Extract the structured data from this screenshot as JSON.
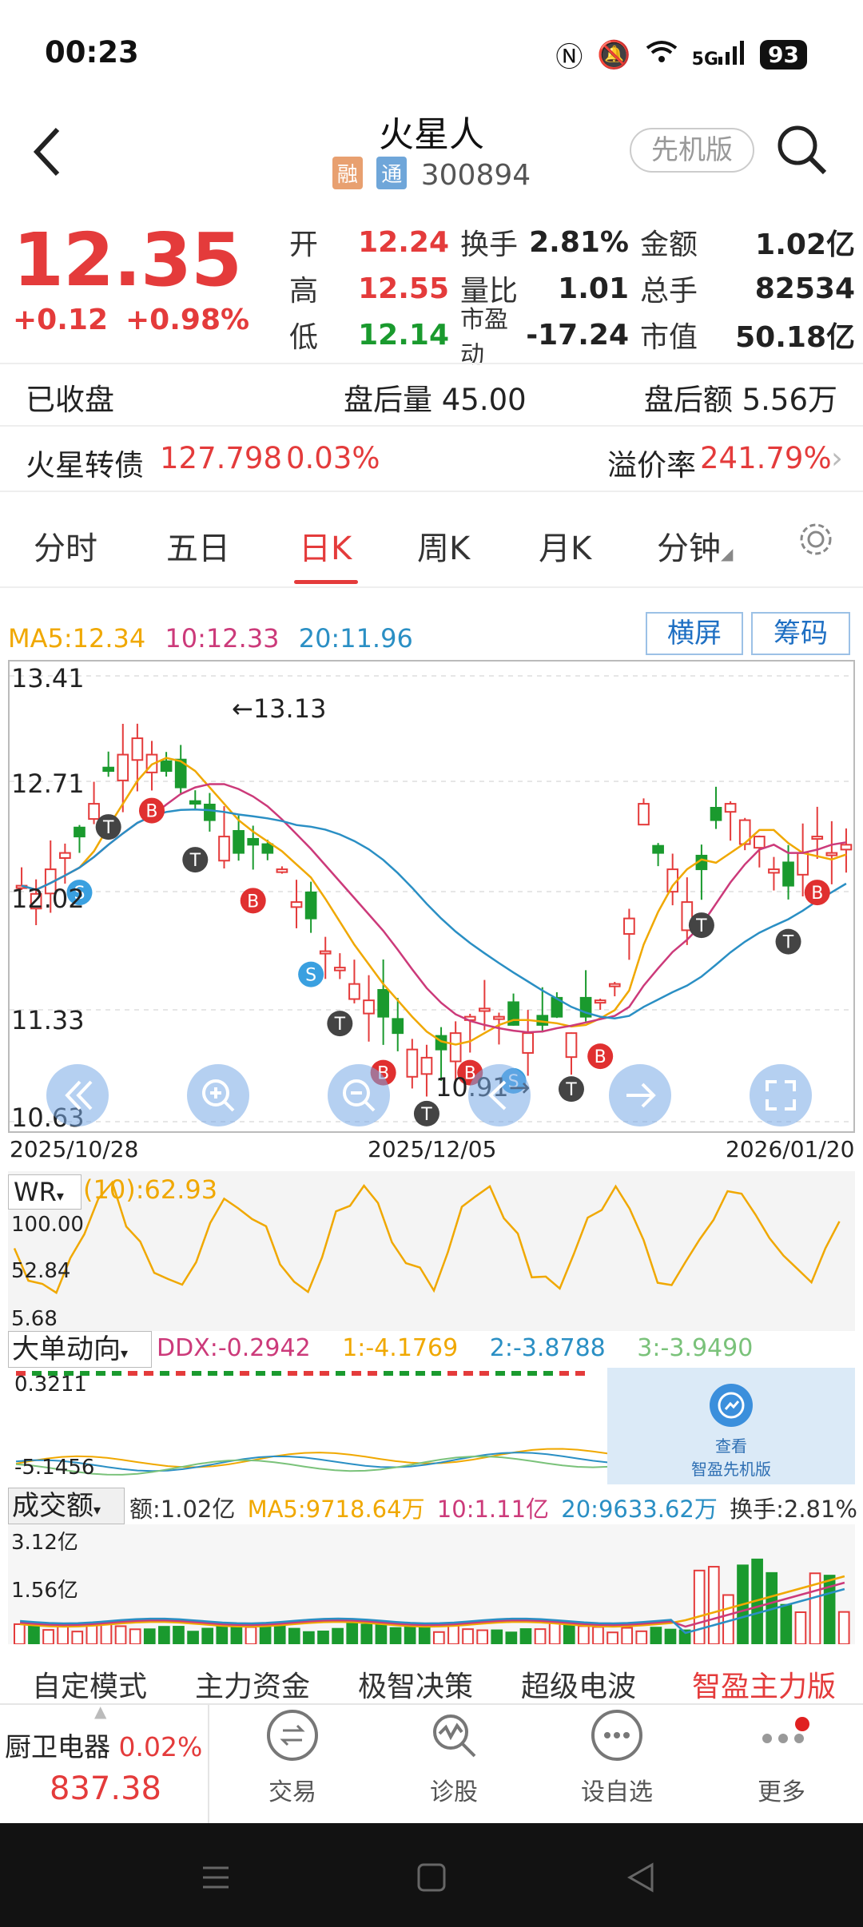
{
  "status": {
    "time": "00:23",
    "battery": "93",
    "signal": "5G"
  },
  "header": {
    "title": "火星人",
    "badge1": "融",
    "badge2": "通",
    "code": "300894",
    "version_btn": "先机版"
  },
  "quote": {
    "price": "12.35",
    "change": "+0.12",
    "change_pct": "+0.98%",
    "rows": [
      {
        "l1": "开",
        "v1": "12.24",
        "l2": "换手",
        "v2": "2.81%",
        "l3": "金额",
        "v3": "1.02亿"
      },
      {
        "l1": "高",
        "v1": "12.55",
        "l2": "量比",
        "v2": "1.01",
        "l3": "总手",
        "v3": "82534"
      },
      {
        "l1": "低",
        "v1": "12.14",
        "l2": "市盈动",
        "v2": "-17.24",
        "l3": "市值",
        "v3": "50.18亿"
      }
    ]
  },
  "after_hours": {
    "status": "已收盘",
    "volume": "盘后量 45.00",
    "amount": "盘后额 5.56万"
  },
  "bond": {
    "name": "火星转债",
    "price": "127.798",
    "pct": "0.03%",
    "premium_label": "溢价率",
    "premium": "241.79%"
  },
  "tabs": [
    "分时",
    "五日",
    "日K",
    "周K",
    "月K",
    "分钟"
  ],
  "active_tab": "日K",
  "ma": {
    "ma5": "MA5:12.34",
    "ma10": "10:12.33",
    "ma20": "20:11.96"
  },
  "buttons": {
    "landscape": "横屏",
    "chips": "筹码"
  },
  "kline": {
    "y_ticks": [
      "13.41",
      "12.71",
      "12.02",
      "11.33",
      "10.63"
    ],
    "dates": [
      "2025/10/28",
      "2025/12/05",
      "2026/01/20"
    ],
    "high_note": "13.13",
    "low_note": "10.91"
  },
  "wr": {
    "name": "WR",
    "value": "(10):62.93",
    "ticks": [
      "100.00",
      "52.84",
      "5.68"
    ]
  },
  "ddx": {
    "name": "大单动向",
    "ddx": "DDX:-0.2942",
    "s1": "1:-4.1769",
    "s2": "2:-3.8788",
    "s3": "3:-3.9490",
    "top": "0.3211",
    "bottom": "-5.1456"
  },
  "promo": {
    "line1": "查看",
    "line2": "智盈先机版"
  },
  "volume": {
    "name": "成交额",
    "amount": "额:1.02亿",
    "ma5": "MA5:9718.64万",
    "ma10": "10:1.11亿",
    "ma20": "20:9633.62万",
    "turnover": "换手:2.81%",
    "top": "3.12亿",
    "mid": "1.56亿"
  },
  "modes": [
    "自定模式",
    "主力资金",
    "极智决策",
    "超级电波",
    "智盈主力版"
  ],
  "index": {
    "name": "厨卫电器",
    "pct": "0.02%",
    "value": "837.38"
  },
  "nav": [
    "交易",
    "诊股",
    "设自选",
    "更多"
  ],
  "colors": {
    "up": "#e43b3b",
    "down": "#1a9a2e",
    "ma5": "#f0a800",
    "ma10": "#cc3a7a",
    "ma20": "#2a8fc4"
  }
}
